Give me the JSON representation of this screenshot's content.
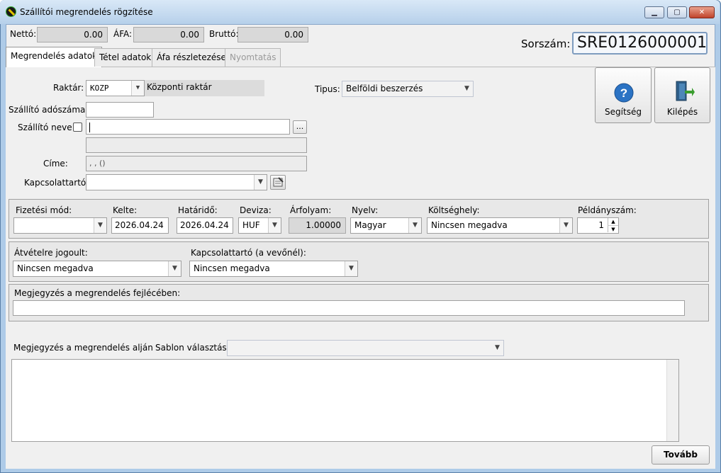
{
  "window": {
    "title": "Szállítói megrendelés rögzítése",
    "min": "▁",
    "max": "▢",
    "close": "✕"
  },
  "totals": {
    "netto_label": "Nettó:",
    "netto_value": "0.00",
    "afa_label": "ÁFA:",
    "afa_value": "0.00",
    "brutto_label": "Bruttó:",
    "brutto_value": "0.00",
    "sorszam_label": "Sorszám:",
    "sorszam_value": "SRE0126000001"
  },
  "tabs": [
    {
      "label": "Megrendelés adatok",
      "state": "active"
    },
    {
      "label": "Tétel adatok",
      "state": "normal"
    },
    {
      "label": "Áfa részletezése",
      "state": "normal"
    },
    {
      "label": "Nyomtatás",
      "state": "disabled"
    }
  ],
  "form": {
    "raktar_label": "Raktár:",
    "raktar_code": "KOZP",
    "raktar_name": "Központi raktár",
    "tipus_label": "Tipus:",
    "tipus_value": "Belföldi beszerzés",
    "adoszam_label": "Szállító adószáma:",
    "adoszam_value": "",
    "nev_label": "Szállító neve:",
    "nev_value": "",
    "browse_label": "...",
    "cime_label": "Címe:",
    "cime_value": ", ,  ()",
    "kapcsolat_label": "Kapcsolattartó:",
    "kapcsolat_value": ""
  },
  "actions": {
    "help_label": "Segítség",
    "exit_label": "Kilépés",
    "next_label": "Tovább"
  },
  "payment": {
    "fizmod_label": "Fizetési mód:",
    "fizmod_value": "",
    "kelte_label": "Kelte:",
    "kelte_value": "2026.04.24",
    "hatarido_label": "Határidő:",
    "hatarido_value": "2026.04.24",
    "deviza_label": "Deviza:",
    "deviza_value": "HUF",
    "arfolyam_label": "Árfolyam:",
    "arfolyam_value": "1.00000",
    "nyelv_label": "Nyelv:",
    "nyelv_value": "Magyar",
    "koltseg_label": "Költséghely:",
    "koltseg_value": "Nincsen megadva",
    "peldany_label": "Példányszám:",
    "peldany_value": "1"
  },
  "receipt": {
    "atvetel_label": "Átvételre jogoult:",
    "atvetel_value": "Nincsen megadva",
    "vevo_kapcs_label": "Kapcsolattartó (a vevőnél):",
    "vevo_kapcs_value": "Nincsen megadva"
  },
  "notes": {
    "fejlec_label": "Megjegyzés a megrendelés fejlécében:",
    "fejlec_value": "",
    "aljan_label": "Megjegyzés a megrendelés alján",
    "sablon_label": "Sablon választás:",
    "sablon_value": "",
    "aljan_value": ""
  },
  "colors": {
    "accent": "#2b73c4",
    "exit_green": "#3a9d2f"
  }
}
